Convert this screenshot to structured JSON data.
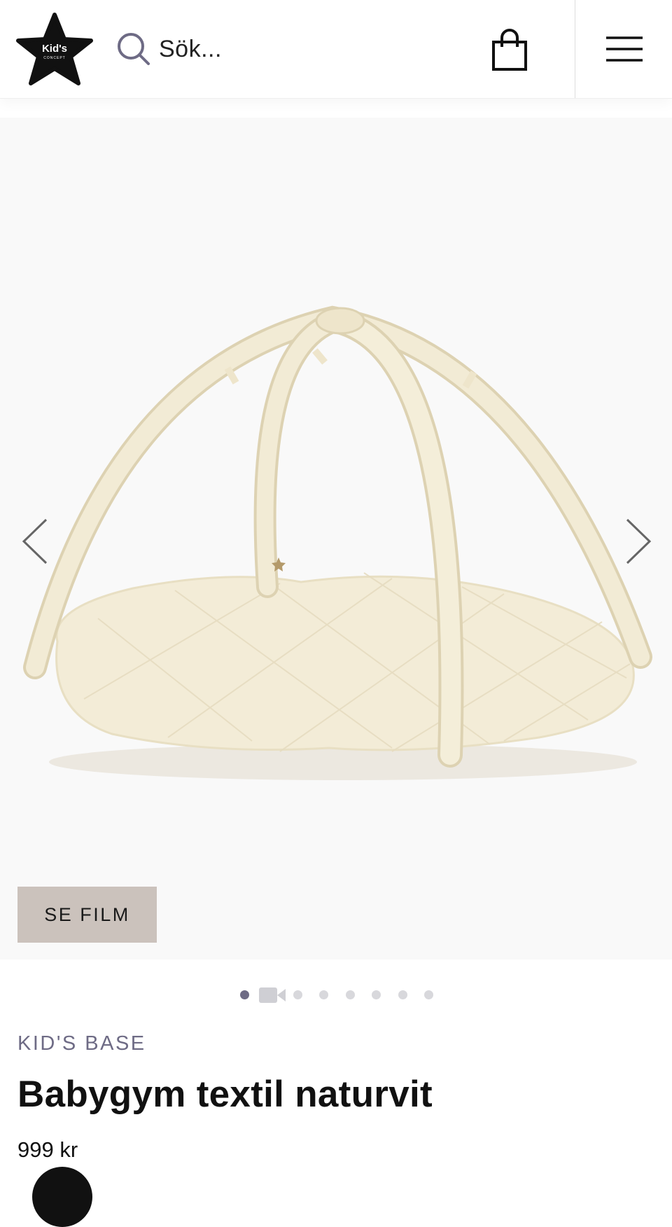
{
  "header": {
    "logo_text_top": "Kid's",
    "logo_text_bottom": "CONCEPT",
    "search_placeholder": "Sök...",
    "icons": {
      "search": "search-icon",
      "cart": "shopping-bag-icon",
      "menu": "hamburger-menu-icon",
      "logo": "star-logo-icon"
    }
  },
  "gallery": {
    "film_button_label": "SE FILM",
    "prev_icon": "chevron-left-icon",
    "next_icon": "chevron-right-icon",
    "slides": [
      {
        "type": "image",
        "active": true
      },
      {
        "type": "video",
        "active": false
      },
      {
        "type": "image",
        "active": false
      },
      {
        "type": "image",
        "active": false
      },
      {
        "type": "image",
        "active": false
      },
      {
        "type": "image",
        "active": false
      },
      {
        "type": "image",
        "active": false
      },
      {
        "type": "image",
        "active": false
      }
    ]
  },
  "product": {
    "brand": "KID'S BASE",
    "title": "Babygym textil naturvit",
    "price": "999 kr"
  },
  "colors": {
    "accent": "#6e6b85",
    "film_button_bg": "#cbc2bc",
    "gallery_bg": "#f9f9f9",
    "product_cream": "#f1e9d2"
  }
}
